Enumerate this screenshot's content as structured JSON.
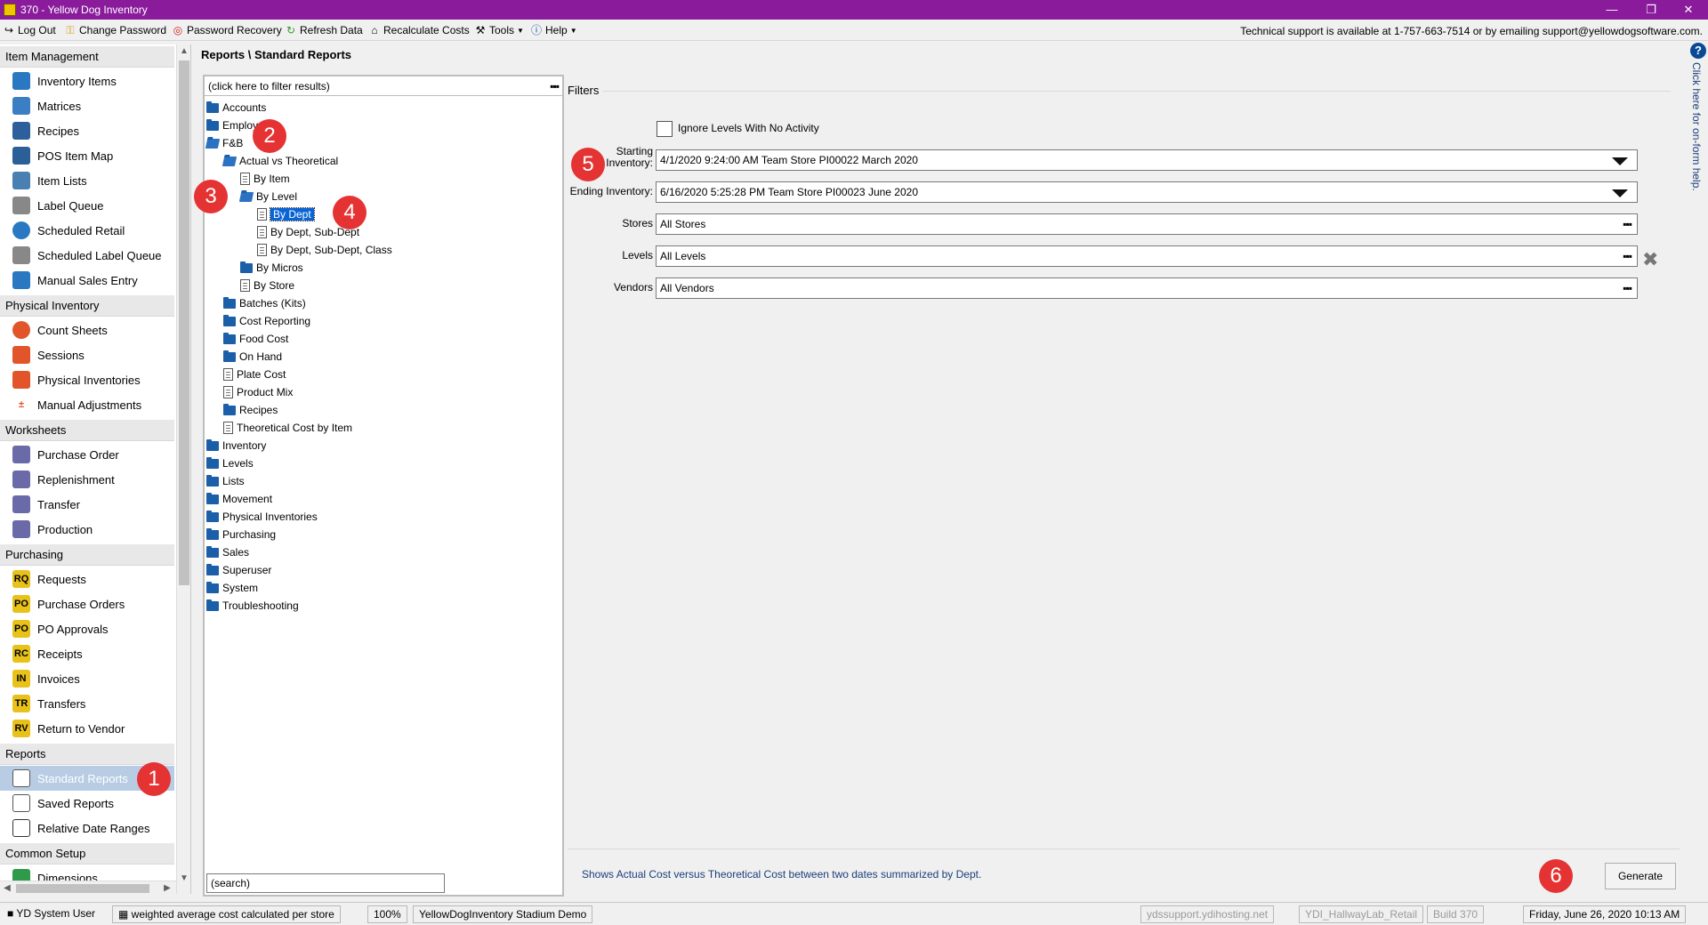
{
  "window": {
    "title": "370 - Yellow Dog Inventory"
  },
  "toolbar": {
    "log_out": "Log Out",
    "change_password": "Change Password",
    "password_recovery": "Password Recovery",
    "refresh_data": "Refresh Data",
    "recalculate_costs": "Recalculate Costs",
    "tools": "Tools",
    "help": "Help",
    "tech_support": "Technical support is available at 1-757-663-7514 or by emailing support@yellowdogsoftware.com."
  },
  "sidebar": {
    "sections": [
      {
        "label": "Item Management",
        "items": [
          "Inventory Items",
          "Matrices",
          "Recipes",
          "POS Item Map",
          "Item Lists",
          "Label Queue",
          "Scheduled Retail",
          "Scheduled Label Queue",
          "Manual Sales Entry"
        ]
      },
      {
        "label": "Physical Inventory",
        "items": [
          "Count Sheets",
          "Sessions",
          "Physical Inventories",
          "Manual Adjustments"
        ]
      },
      {
        "label": "Worksheets",
        "items": [
          "Purchase Order",
          "Replenishment",
          "Transfer",
          "Production"
        ]
      },
      {
        "label": "Purchasing",
        "items": [
          "Requests",
          "Purchase Orders",
          "PO Approvals",
          "Receipts",
          "Invoices",
          "Transfers",
          "Return to Vendor"
        ]
      },
      {
        "label": "Reports",
        "items": [
          "Standard Reports",
          "Saved Reports",
          "Relative Date Ranges"
        ]
      },
      {
        "label": "Common Setup",
        "items": [
          "Dimensions"
        ]
      }
    ],
    "selected": "Standard Reports"
  },
  "breadcrumb": "Reports \\ Standard Reports",
  "tree": {
    "filter_placeholder": "(click here to filter results)",
    "search_placeholder": "(search)",
    "nodes": {
      "accounts": "Accounts",
      "employees": "Employ",
      "fnb": "F&B",
      "actual_vs_theoretical": "Actual vs Theoretical",
      "by_item": "By Item",
      "by_level": "By Level",
      "by_dept": "By Dept",
      "by_dept_subdept": "By Dept, Sub-Dept",
      "by_dept_subdept_class": "By Dept, Sub-Dept, Class",
      "by_micros": "By Micros",
      "by_store": "By Store",
      "batches": "Batches (Kits)",
      "cost_reporting": "Cost Reporting",
      "food_cost": "Food Cost",
      "on_hand": "On Hand",
      "plate_cost": "Plate Cost",
      "product_mix": "Product Mix",
      "recipes": "Recipes",
      "theoretical_cost_by_item": "Theoretical Cost by Item",
      "inventory": "Inventory",
      "levels": "Levels",
      "lists": "Lists",
      "movement": "Movement",
      "physical_inventories": "Physical Inventories",
      "purchasing": "Purchasing",
      "sales": "Sales",
      "superuser": "Superuser",
      "system": "System",
      "troubleshooting": "Troubleshooting"
    },
    "selected": "By Dept"
  },
  "filters": {
    "label": "Filters",
    "ignore_levels_label": "Ignore Levels With No Activity",
    "ignore_levels_checked": false,
    "starting_inventory_label_1": "Starting",
    "starting_inventory_label_2": "Inventory:",
    "starting_inventory_value": "4/1/2020 9:24:00 AM Team Store PI00022 March 2020",
    "ending_inventory_label": "Ending Inventory:",
    "ending_inventory_value": "6/16/2020 5:25:28 PM Team Store PI00023 June 2020",
    "stores_label": "Stores",
    "stores_value": "All Stores",
    "levels_label": "Levels",
    "levels_value": "All Levels",
    "vendors_label": "Vendors",
    "vendors_value": "All Vendors"
  },
  "description": "Shows Actual Cost versus Theoretical Cost between two dates summarized by Dept.",
  "generate_label": "Generate",
  "help_strip_text": "Click here for on-form help.",
  "statusbar": {
    "user": "YD System User",
    "cost_method": "weighted average cost calculated per store",
    "zoom": "100%",
    "database": "YellowDogInventory Stadium Demo",
    "server": "ydssupport.ydihosting.net",
    "instance": "YDI_HallwayLab_Retail",
    "build": "Build 370",
    "datetime": "Friday, June 26, 2020 10:13 AM"
  },
  "callouts": [
    "1",
    "2",
    "3",
    "4",
    "5",
    "6"
  ],
  "colors": {
    "titlebar": "#8a1c9c",
    "selection": "#0a64d4",
    "callout": "#e53333",
    "folder": "#1b5fa8"
  }
}
